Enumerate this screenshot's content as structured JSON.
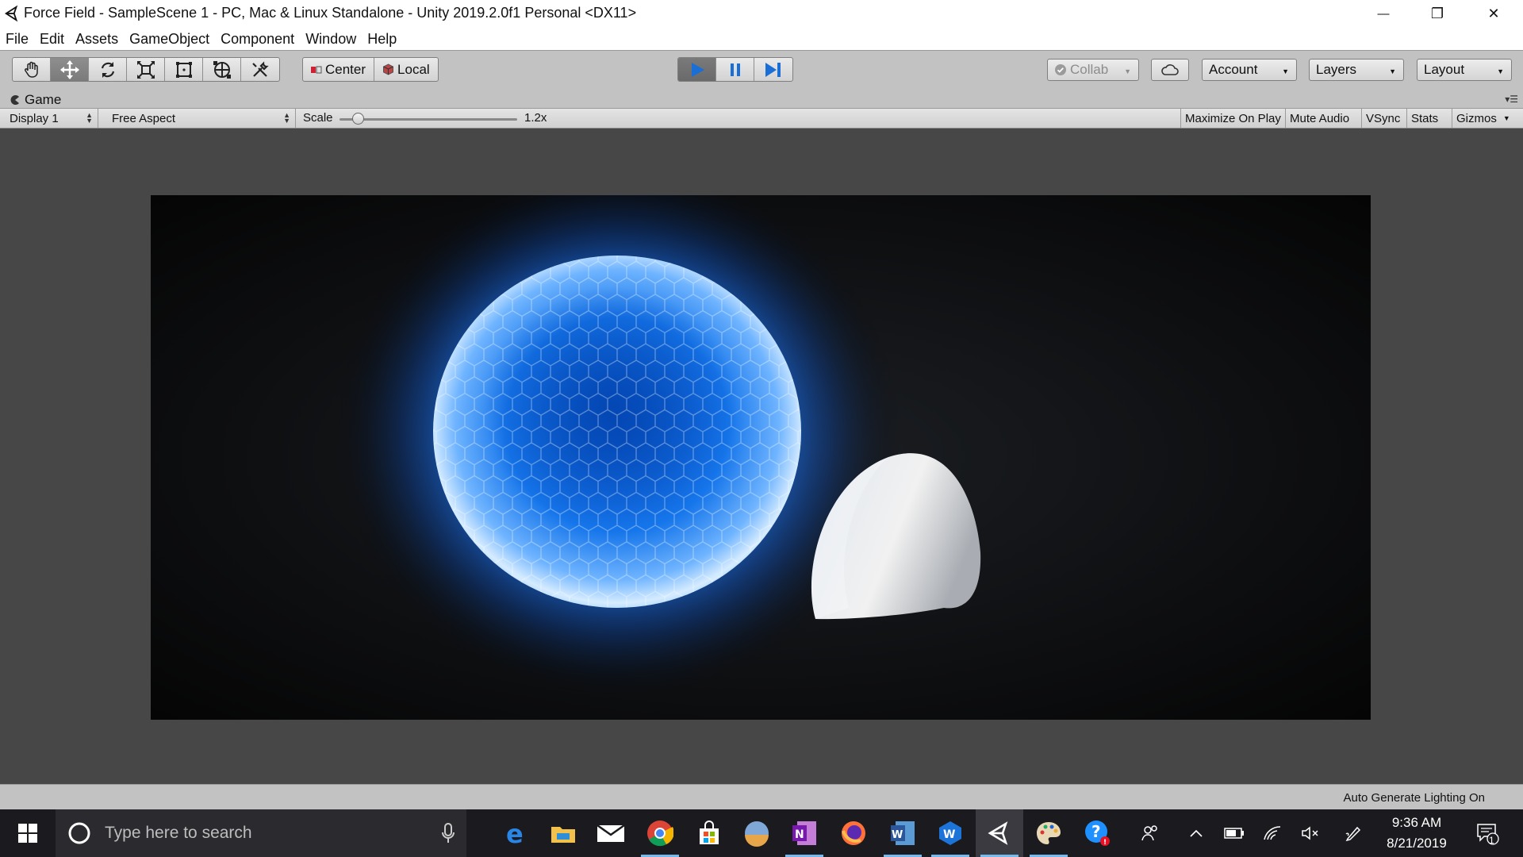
{
  "window": {
    "title": "Force Field - SampleScene 1 - PC, Mac & Linux Standalone - Unity 2019.2.0f1 Personal <DX11>",
    "minimize_glyph": "—",
    "restore_glyph": "❐",
    "close_glyph": "✕"
  },
  "menu": [
    "File",
    "Edit",
    "Assets",
    "GameObject",
    "Component",
    "Window",
    "Help"
  ],
  "toolbar": {
    "transform_tools": [
      "hand-tool-icon",
      "move-tool-icon",
      "rotate-tool-icon",
      "scale-tool-icon",
      "rect-tool-icon",
      "transform-tool-icon",
      "custom-tool-icon"
    ],
    "active_tool": "move-tool-icon",
    "pivot_mode_label": "Center",
    "pivot_rotation_label": "Local",
    "play_controls": [
      "play-icon",
      "pause-icon",
      "step-icon"
    ],
    "playing": true,
    "collab_label": "Collab",
    "account_label": "Account",
    "layers_label": "Layers",
    "layout_label": "Layout",
    "accent_color": "#1a6fd6"
  },
  "game_panel": {
    "tab_label": "Game",
    "display": "Display 1",
    "aspect": "Free Aspect",
    "scale_label": "Scale",
    "scale_value": "1.2x",
    "toggles": [
      "Maximize On Play",
      "Mute Audio",
      "VSync",
      "Stats",
      "Gizmos"
    ]
  },
  "status": {
    "text": "Auto Generate Lighting On"
  },
  "taskbar": {
    "search_placeholder": "Type here to search",
    "apps": [
      "edge-icon",
      "file-explorer-icon",
      "chrome-icon",
      "mail-icon",
      "store-icon",
      "photos-icon",
      "onenote-icon",
      "firefox-icon",
      "word-icon",
      "wps-icon",
      "unity-icon",
      "paint-icon",
      "help-icon"
    ],
    "time": "9:36 AM",
    "date": "8/21/2019",
    "notification_count": "1"
  }
}
